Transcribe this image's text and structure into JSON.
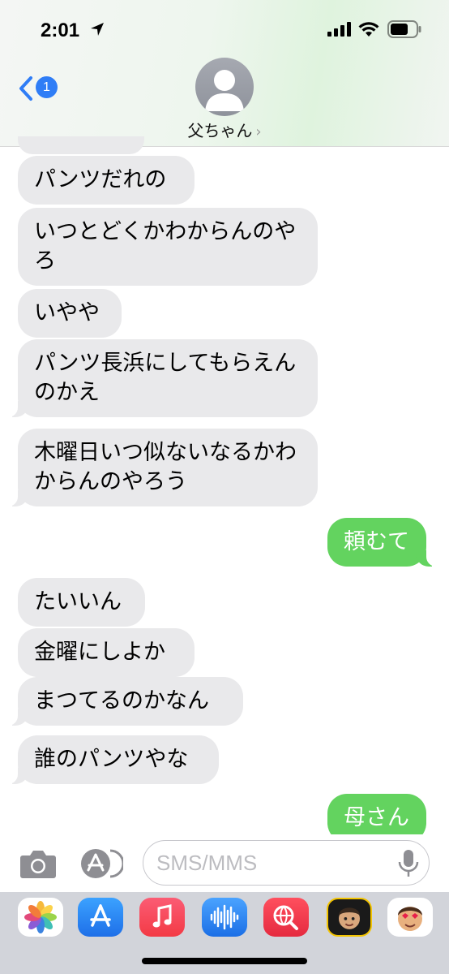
{
  "status_bar": {
    "time": "2:01"
  },
  "header": {
    "back_badge": "1",
    "contact_name": "父ちゃん",
    "chevron": "›"
  },
  "messages": [
    {
      "direction": "in",
      "text": "パンツだれの"
    },
    {
      "direction": "in",
      "text": "いつとどくかわからんのやろ"
    },
    {
      "direction": "in",
      "text": "いやや"
    },
    {
      "direction": "in",
      "text": "パンツ長浜にしてもらえんのかえ"
    },
    {
      "direction": "in",
      "text": "木曜日いつ似ないなるかわからんのやろう"
    },
    {
      "direction": "out",
      "text": "頼むて"
    },
    {
      "direction": "in",
      "text": "たいいん"
    },
    {
      "direction": "in",
      "text": "金曜にしよか"
    },
    {
      "direction": "in",
      "text": "まつてるのかなん"
    },
    {
      "direction": "in",
      "text": "誰のパンツやな"
    },
    {
      "direction": "out",
      "text": "母さん"
    }
  ],
  "input": {
    "placeholder": "SMS/MMS"
  },
  "app_drawer": [
    {
      "name": "photos-icon"
    },
    {
      "name": "app-store-icon"
    },
    {
      "name": "music-icon"
    },
    {
      "name": "audio-message-icon"
    },
    {
      "name": "web-search-icon"
    },
    {
      "name": "memoji-icon"
    },
    {
      "name": "memoji-stickers-icon"
    }
  ],
  "colors": {
    "incoming_bubble": "#e9e9eb",
    "outgoing_bubble": "#63d35f",
    "accent": "#2f7df6"
  }
}
